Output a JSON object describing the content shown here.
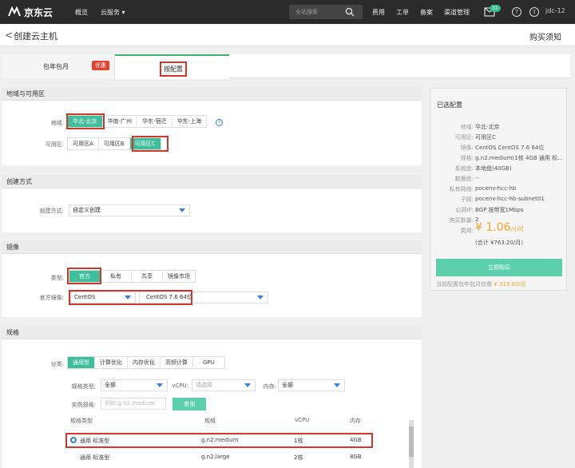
{
  "topbar": {
    "logo": "京东云",
    "nav": [
      "概览",
      "云服务 ▾"
    ],
    "search_placeholder": "全站搜索",
    "links": [
      "费用",
      "工单",
      "备案",
      "渠道管理"
    ],
    "msg_count": "31",
    "user": "jdc-12"
  },
  "header": {
    "back": "<",
    "title": "创建云主机",
    "notice": "购买须知"
  },
  "tabs": {
    "monthly": "包年包月",
    "monthly_badge": "优惠",
    "payg": "按配置"
  },
  "region": {
    "title": "地域与可用区",
    "region_label": "地域:",
    "regions": [
      "华北-北京",
      "华南-广州",
      "华东-宿迁",
      "华东-上海"
    ],
    "zone_label": "可用区:",
    "zones": [
      "可用区A",
      "可用区B",
      "可用区C"
    ]
  },
  "create": {
    "title": "创建方式",
    "label": "创建方式:",
    "value": "自定义创建"
  },
  "image": {
    "title": "镜像",
    "type_label": "类型:",
    "types": [
      "官方",
      "私有",
      "共享",
      "镜像市场"
    ],
    "official_label": "官方镜像:",
    "os": "CentOS",
    "version": "CentOS 7.6 64位"
  },
  "spec": {
    "title": "规格",
    "cat_label": "分类:",
    "cats": [
      "通用型",
      "计算优化",
      "内存优化",
      "高频计算",
      "GPU"
    ],
    "type_label": "规格类型:",
    "type_value": "全部",
    "vcpu_label": "vCPU:",
    "vcpu_placeholder": "请选择",
    "mem_label": "内存:",
    "mem_value": "全部",
    "inst_label": "实例规格:",
    "inst_placeholder": "例如:g.n2.medium",
    "query": "查询",
    "headers": [
      "规格类型",
      "规格",
      "vCPU",
      "内存"
    ],
    "rows": [
      [
        "通用 标准型",
        "g.n2.medium",
        "1核",
        "4GB"
      ],
      [
        "通用 标准型",
        "g.n2.large",
        "2核",
        "8GB"
      ]
    ]
  },
  "summary": {
    "title": "已选配置",
    "rows": [
      [
        "地域:",
        "华北-北京"
      ],
      [
        "可用区:",
        "可用区C"
      ],
      [
        "镜像:",
        "CentOS CentOS 7.6 64位"
      ],
      [
        "规格:",
        "g.n2.medium(1核 4GB 通用 标..."
      ],
      [
        "系统盘:",
        "本地盘(40GB)"
      ],
      [
        "数据盘:",
        "--"
      ],
      [
        "私有网络:",
        "pocenv-hcc-hb"
      ],
      [
        "子网:",
        "pocenv-hcc-hb-subnet01"
      ],
      [
        "公网IP:",
        "BGP 按带宽1Mbps"
      ],
      [
        "购买数量:",
        "2"
      ]
    ],
    "price_label": "费用:",
    "price": "¥ 1.06",
    "price_unit": "/小时",
    "total": "(合计 ¥763.20/月)",
    "buy": "立即购买",
    "hint_prefix": "当前配置包年包月仅需",
    "hint_price": "¥ 319.00/月"
  },
  "colors": {
    "accent": "#3dbf9b",
    "highlight": "#d0382e",
    "price": "#f5a623"
  }
}
